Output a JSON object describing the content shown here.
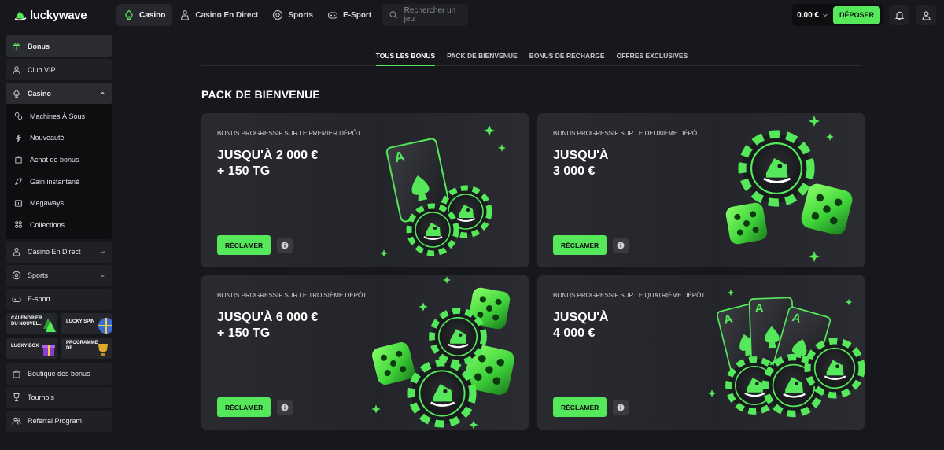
{
  "brand": {
    "name": "luckywave",
    "accent": "#55e85a"
  },
  "nav": [
    {
      "label": "Casino",
      "icon": "spade-icon",
      "active": true
    },
    {
      "label": "Casino En Direct",
      "icon": "dealer-icon"
    },
    {
      "label": "Sports",
      "icon": "football-icon"
    },
    {
      "label": "E-Sport",
      "icon": "gamepad-icon"
    }
  ],
  "search": {
    "placeholder": "Rechercher un jeu"
  },
  "wallet": {
    "balance": "0.00 €",
    "deposit_label": "DÉPOSER"
  },
  "sidebar": {
    "bonus": "Bonus",
    "vip": "Club VIP",
    "casino": "Casino",
    "casino_items": [
      "Machines À Sous",
      "Nouveauté",
      "Achat de bonus",
      "Gain instantané",
      "Megaways",
      "Collections"
    ],
    "live_casino": "Casino En Direct",
    "sports": "Sports",
    "esport": "E-sport",
    "promos": [
      "CALENDRIER DU NOUVEL...",
      "LUCKY SPIN",
      "LUCKY BOX",
      "PROGRAMME DE..."
    ],
    "shop": "Boutique des bonus",
    "tournaments": "Tournois",
    "referral": "Referral Program"
  },
  "tabs": [
    "TOUS LES BONUS",
    "PACK DE BIENVENUE",
    "BONUS DE RECHARGE",
    "OFFRES EXCLUSIVES"
  ],
  "section_title": "PACK DE BIENVENUE",
  "cards": [
    {
      "subtitle": "BONUS PROGRESSIF SUR LE PREMIER DÉPÔT",
      "amount_line1": "JUSQU'À 2 000 €",
      "amount_line2": "+ 150 TG",
      "claim": "RÉCLAMER"
    },
    {
      "subtitle": "BONUS PROGRESSIF SUR LE DEUXIÈME DÉPÔT",
      "amount_line1": "JUSQU'À",
      "amount_line2": "3 000 €",
      "claim": "RÉCLAMER"
    },
    {
      "subtitle": "BONUS PROGRESSIF SUR LE TROISIÈME DÉPÔT",
      "amount_line1": "JUSQU'À 6 000 €",
      "amount_line2": "+ 150 TG",
      "claim": "RÉCLAMER"
    },
    {
      "subtitle": "BONUS PROGRESSIF SUR LE QUATRIÈME DÉPÔT",
      "amount_line1": "JUSQU'À",
      "amount_line2": "4 000 €",
      "claim": "RÉCLAMER"
    }
  ]
}
